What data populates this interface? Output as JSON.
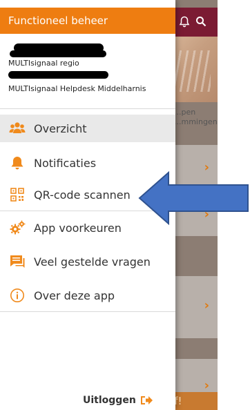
{
  "drawer": {
    "title": "Functioneel beheer",
    "org_line1": "MULTIsignaal regio",
    "org_line2": "MULTIsignaal Helpdesk Middelharnis",
    "menu": [
      {
        "label": "Overzicht",
        "icon": "people-icon",
        "active": true
      },
      {
        "label": "Notificaties",
        "icon": "bell-icon",
        "active": false
      },
      {
        "label": "QR-code scannen",
        "icon": "qr-code-icon",
        "active": false
      },
      {
        "label": "App voorkeuren",
        "icon": "gears-icon",
        "active": false
      },
      {
        "label": "Veel gestelde vragen",
        "icon": "chat-icon",
        "active": false
      },
      {
        "label": "Over deze app",
        "icon": "info-icon",
        "active": false
      }
    ],
    "logout_label": "Uitloggen"
  },
  "background_app": {
    "partial_label": "...pen ...mmingen",
    "bottom_text": "af!"
  },
  "colors": {
    "header_orange": "#ee7d11",
    "icon_orange": "#f08a1c",
    "app_topbar": "#7b1b33",
    "annotation_arrow": "#4472c4"
  }
}
